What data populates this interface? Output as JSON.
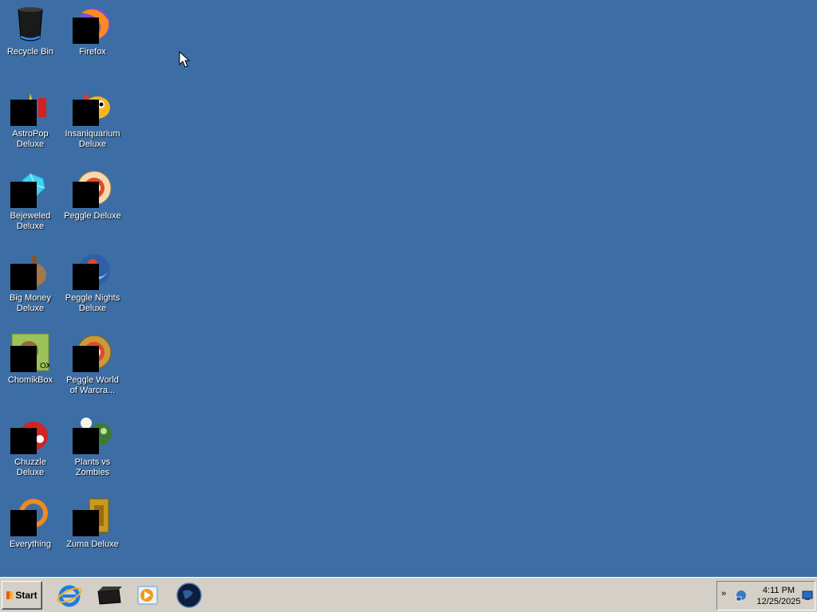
{
  "desktop": {
    "background_color": "#3c6ea5",
    "icons": [
      {
        "label": "Recycle Bin",
        "icon": "recycle-bin-icon"
      },
      {
        "label": "Firefox",
        "icon": "firefox-icon"
      },
      {
        "label": "AstroPop Deluxe",
        "icon": "astropop-icon"
      },
      {
        "label": "Insaniquarium Deluxe",
        "icon": "insaniquarium-icon"
      },
      {
        "label": "Bejeweled Deluxe",
        "icon": "bejeweled-icon"
      },
      {
        "label": "Peggle Deluxe",
        "icon": "peggle-icon"
      },
      {
        "label": "Big Money Deluxe",
        "icon": "big-money-icon"
      },
      {
        "label": "Peggle Nights Deluxe",
        "icon": "peggle-nights-icon"
      },
      {
        "label": "ChomikBox",
        "icon": "chomikbox-icon"
      },
      {
        "label": "Peggle World of Warcra...",
        "icon": "peggle-wow-icon"
      },
      {
        "label": "Chuzzle Deluxe",
        "icon": "chuzzle-icon"
      },
      {
        "label": "Plants vs Zombies",
        "icon": "plants-vs-zombies-icon"
      },
      {
        "label": "Everything",
        "icon": "everything-icon"
      },
      {
        "label": "Zuma Deluxe",
        "icon": "zuma-icon"
      }
    ]
  },
  "taskbar": {
    "start_label": "Start",
    "quick_launch": [
      {
        "icon": "internet-explorer-icon"
      },
      {
        "icon": "terminal-icon"
      },
      {
        "icon": "media-player-icon"
      },
      {
        "icon": "globe-icon"
      }
    ],
    "tray": {
      "time": "4:11 PM",
      "date": "12/25/2025",
      "expand_glyph": "»"
    }
  }
}
